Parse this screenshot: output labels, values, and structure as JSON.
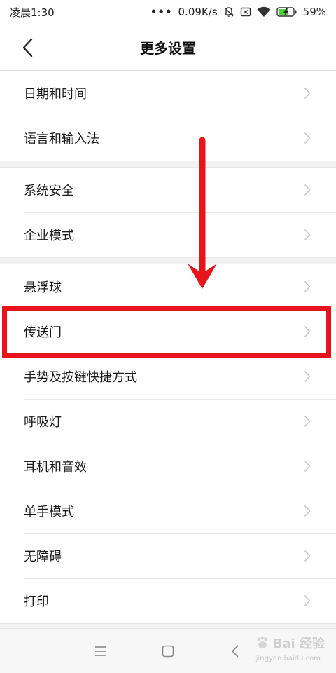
{
  "status_bar": {
    "time": "凌晨1:30",
    "dots": "•••",
    "network_speed": "0.09K/s",
    "battery": "59%",
    "icons": [
      "mute-bell-icon",
      "sim-x-icon",
      "wifi-icon",
      "battery-charging-icon"
    ]
  },
  "header": {
    "title": "更多设置",
    "back_icon": "chevron-left-icon"
  },
  "groups": [
    {
      "items": [
        {
          "label": "日期和时间"
        },
        {
          "label": "语言和输入法"
        }
      ]
    },
    {
      "items": [
        {
          "label": "系统安全"
        },
        {
          "label": "企业模式"
        }
      ]
    },
    {
      "items": [
        {
          "label": "悬浮球"
        },
        {
          "label": "传送门"
        },
        {
          "label": "手势及按键快捷方式"
        },
        {
          "label": "呼吸灯"
        },
        {
          "label": "耳机和音效"
        },
        {
          "label": "单手模式"
        },
        {
          "label": "无障碍"
        },
        {
          "label": "打印"
        }
      ]
    }
  ],
  "annotation": {
    "highlighted_item": "传送门",
    "color": "#e8141b"
  },
  "nav_bar": {
    "buttons": [
      "menu-icon",
      "home-square-icon",
      "back-triangle-icon"
    ]
  },
  "watermark": {
    "text": "Bai 经验",
    "sub": "jingyan.baidu.com"
  },
  "colors": {
    "separator": "#eaeaea",
    "group_gap": "#f2f2f2",
    "chevron": "#c4c4c4"
  }
}
